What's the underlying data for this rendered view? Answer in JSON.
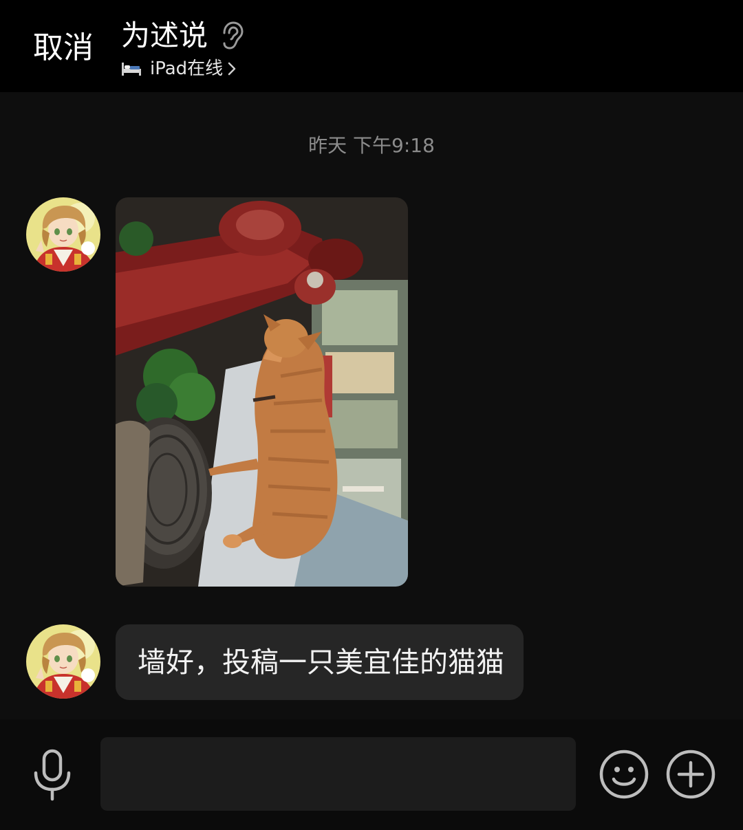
{
  "header": {
    "cancel_label": "取消",
    "title": "为述说",
    "status_text": "iPad在线",
    "icons": {
      "listen": "ear-icon",
      "device": "bed-icon",
      "more": "chevron-right-icon"
    }
  },
  "chat": {
    "timestamp": "昨天 下午9:18",
    "messages": [
      {
        "type": "image",
        "content": "cat-photo"
      },
      {
        "type": "text",
        "text": "墙好，投稿一只美宜佳的猫猫"
      }
    ]
  },
  "input_bar": {
    "value": "",
    "placeholder": "",
    "icons": {
      "voice": "microphone-icon",
      "emoji": "smiley-icon",
      "more": "plus-icon"
    }
  },
  "colors": {
    "header_bg": "#000000",
    "chat_bg": "#0e0e0e",
    "bubble_bg": "#262626",
    "input_bg": "#1c1c1c",
    "timestamp": "#8c8c8c",
    "icon_gray": "#bdbdbd"
  }
}
